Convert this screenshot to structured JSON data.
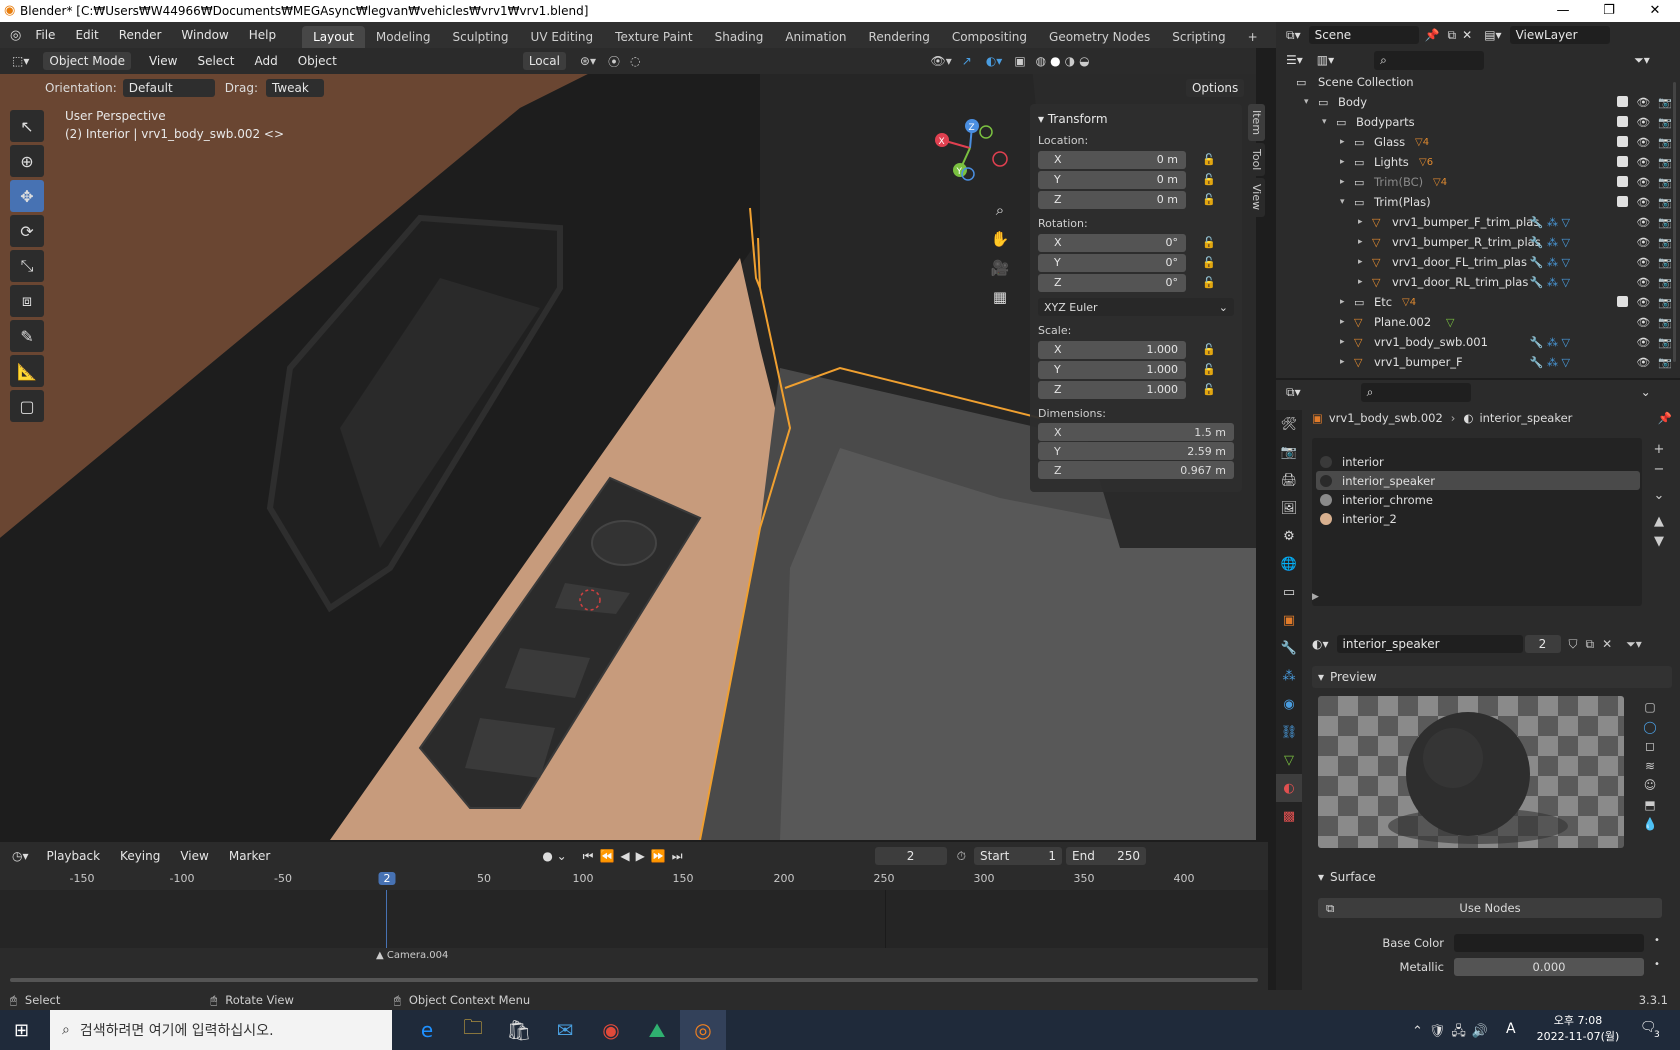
{
  "window": {
    "title": "Blender* [C:₩Users₩W44966₩Documents₩MEGAsync₩legvan₩vehicles₩vrv1₩vrv1.blend]"
  },
  "menus": [
    "File",
    "Edit",
    "Render",
    "Window",
    "Help"
  ],
  "workspaces": [
    "Layout",
    "Modeling",
    "Sculpting",
    "UV Editing",
    "Texture Paint",
    "Shading",
    "Animation",
    "Rendering",
    "Compositing",
    "Geometry Nodes",
    "Scripting"
  ],
  "active_workspace": "Layout",
  "scene": {
    "name": "Scene",
    "view_layer": "ViewLayer"
  },
  "viewport": {
    "mode": "Object Mode",
    "menus": [
      "View",
      "Select",
      "Add",
      "Object"
    ],
    "transform_orientation": "Local",
    "orientation_label": "Orientation:",
    "orientation_value": "Default",
    "drag_label": "Drag:",
    "drag_value": "Tweak",
    "options_label": "Options",
    "perspective_text": "User Perspective",
    "object_info": "(2) Interior | vrv1_body_swb.002 <>"
  },
  "npanel": {
    "tabs": [
      "Item",
      "Tool",
      "View"
    ],
    "title": "Transform",
    "location_label": "Location:",
    "location": [
      {
        "axis": "X",
        "value": "0 m"
      },
      {
        "axis": "Y",
        "value": "0 m"
      },
      {
        "axis": "Z",
        "value": "0 m"
      }
    ],
    "rotation_label": "Rotation:",
    "rotation": [
      {
        "axis": "X",
        "value": "0°"
      },
      {
        "axis": "Y",
        "value": "0°"
      },
      {
        "axis": "Z",
        "value": "0°"
      }
    ],
    "rotation_mode": "XYZ Euler",
    "scale_label": "Scale:",
    "scale": [
      {
        "axis": "X",
        "value": "1.000"
      },
      {
        "axis": "Y",
        "value": "1.000"
      },
      {
        "axis": "Z",
        "value": "1.000"
      }
    ],
    "dimensions_label": "Dimensions:",
    "dimensions": [
      {
        "axis": "X",
        "value": "1.5 m"
      },
      {
        "axis": "Y",
        "value": "2.59 m"
      },
      {
        "axis": "Z",
        "value": "0.967 m"
      }
    ]
  },
  "timeline": {
    "menus": [
      "Playback",
      "Keying",
      "View",
      "Marker"
    ],
    "current_frame": "2",
    "start_label": "Start",
    "start": "1",
    "end_label": "End",
    "end": "250",
    "ticks": [
      "-150",
      "-100",
      "-50",
      "2",
      "50",
      "100",
      "150",
      "200",
      "250",
      "300",
      "350",
      "400"
    ],
    "marker": "Camera.004"
  },
  "outliner": {
    "root": "Scene Collection",
    "rows": [
      {
        "name": "Body",
        "level": 0,
        "type": "collection",
        "count": ""
      },
      {
        "name": "Bodyparts",
        "level": 1,
        "type": "collection",
        "count": ""
      },
      {
        "name": "Glass",
        "level": 2,
        "type": "collection",
        "count": "4"
      },
      {
        "name": "Lights",
        "level": 2,
        "type": "collection",
        "count": "6"
      },
      {
        "name": "Trim(BC)",
        "level": 2,
        "type": "collection",
        "count": "4"
      },
      {
        "name": "Trim(Plas)",
        "level": 2,
        "type": "collection",
        "count": ""
      },
      {
        "name": "vrv1_bumper_F_trim_plas",
        "level": 3,
        "type": "mesh",
        "count": ""
      },
      {
        "name": "vrv1_bumper_R_trim_plas",
        "level": 3,
        "type": "mesh",
        "count": ""
      },
      {
        "name": "vrv1_door_FL_trim_plas",
        "level": 3,
        "type": "mesh",
        "count": ""
      },
      {
        "name": "vrv1_door_RL_trim_plas",
        "level": 3,
        "type": "mesh",
        "count": ""
      },
      {
        "name": "Etc",
        "level": 2,
        "type": "collection",
        "count": "4"
      },
      {
        "name": "Plane.002",
        "level": 2,
        "type": "mesh",
        "count": ""
      },
      {
        "name": "vrv1_body_swb.001",
        "level": 2,
        "type": "mesh",
        "count": ""
      },
      {
        "name": "vrv1_bumper_F",
        "level": 2,
        "type": "mesh",
        "count": ""
      }
    ]
  },
  "properties": {
    "object": "vrv1_body_swb.002",
    "material": "interior_speaker",
    "slots": [
      {
        "name": "interior",
        "color": "#3a3a3a"
      },
      {
        "name": "interior_speaker",
        "color": "#2a2a2a"
      },
      {
        "name": "interior_chrome",
        "color": "#8a8a8a"
      },
      {
        "name": "interior_2",
        "color": "#d8b08f"
      }
    ],
    "active_slot": "interior_speaker",
    "material_field": "interior_speaker",
    "users": "2",
    "preview_label": "Preview",
    "surface_label": "Surface",
    "use_nodes": "Use Nodes",
    "base_color_label": "Base Color",
    "metallic_label": "Metallic",
    "metallic_value": "0.000"
  },
  "status": {
    "left": "Select",
    "middle": "Rotate View",
    "right": "Object Context Menu",
    "version": "3.3.1"
  },
  "taskbar": {
    "search_placeholder": "검색하려면 여기에 입력하십시오.",
    "time": "오후 7:08",
    "date": "2022-11-07(월)",
    "ime": "A",
    "notif": "3"
  }
}
